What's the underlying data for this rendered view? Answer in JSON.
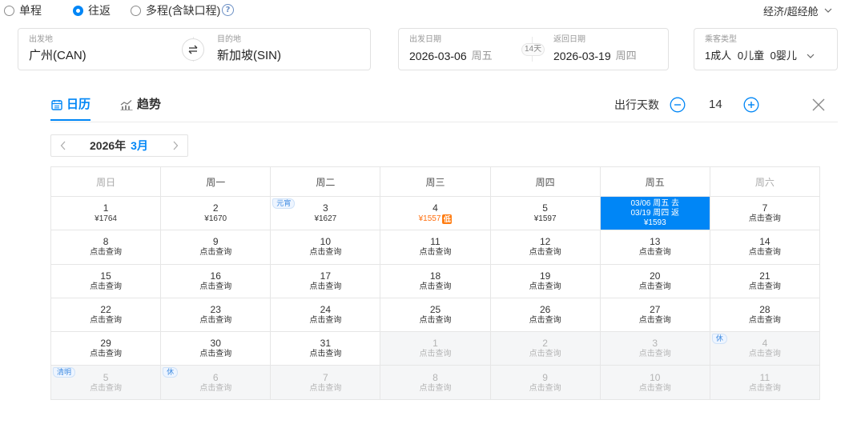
{
  "trip_type": {
    "options": [
      {
        "label": "单程",
        "checked": false
      },
      {
        "label": "往返",
        "checked": true
      },
      {
        "label": "多程(含缺口程)",
        "checked": false
      }
    ],
    "help_icon": "question-circle-icon"
  },
  "cabin": {
    "label": "经济/超经舱",
    "icon": "chevron-down-icon"
  },
  "search": {
    "origin": {
      "label": "出发地",
      "value": "广州(CAN)"
    },
    "swap_icon": "swap-arrows-icon",
    "destination": {
      "label": "目的地",
      "value": "新加坡(SIN)"
    },
    "depart": {
      "label": "出发日期",
      "date": "2026-03-06",
      "weekday": "周五"
    },
    "duration_badge": "14天",
    "return": {
      "label": "返回日期",
      "date": "2026-03-19",
      "weekday": "周四"
    },
    "passengers": {
      "label": "乘客类型",
      "value": "1成人 0儿童 0婴儿"
    }
  },
  "tabs": [
    {
      "label": "日历",
      "icon": "calendar-icon",
      "active": true
    },
    {
      "label": "趋势",
      "icon": "trend-chart-icon",
      "active": false
    }
  ],
  "trip_days": {
    "label": "出行天数",
    "value": "14",
    "decrement_icon": "minus-circle-icon",
    "increment_icon": "plus-circle-icon"
  },
  "close_icon": "close-icon",
  "month_nav": {
    "year": "2026年",
    "month": "3月"
  },
  "calendar": {
    "weekdays": [
      "周日",
      "周一",
      "周二",
      "周三",
      "周四",
      "周五",
      "周六"
    ],
    "weeks": [
      [
        {
          "day": "1",
          "sub": "¥1764"
        },
        {
          "day": "2",
          "sub": "¥1670"
        },
        {
          "day": "3",
          "sub": "¥1627",
          "tag": "元宵"
        },
        {
          "day": "4",
          "sub": "¥1557",
          "low_badge": "低"
        },
        {
          "day": "5",
          "sub": "¥1597"
        },
        {
          "selected": true,
          "lines": [
            "03/06 周五 去",
            "03/19 周四 返",
            "¥1593"
          ]
        },
        {
          "day": "7",
          "sub": "点击查询"
        }
      ],
      [
        {
          "day": "8",
          "sub": "点击查询"
        },
        {
          "day": "9",
          "sub": "点击查询"
        },
        {
          "day": "10",
          "sub": "点击查询"
        },
        {
          "day": "11",
          "sub": "点击查询"
        },
        {
          "day": "12",
          "sub": "点击查询"
        },
        {
          "day": "13",
          "sub": "点击查询"
        },
        {
          "day": "14",
          "sub": "点击查询"
        }
      ],
      [
        {
          "day": "15",
          "sub": "点击查询"
        },
        {
          "day": "16",
          "sub": "点击查询"
        },
        {
          "day": "17",
          "sub": "点击查询"
        },
        {
          "day": "18",
          "sub": "点击查询"
        },
        {
          "day": "19",
          "sub": "点击查询"
        },
        {
          "day": "20",
          "sub": "点击查询"
        },
        {
          "day": "21",
          "sub": "点击查询"
        }
      ],
      [
        {
          "day": "22",
          "sub": "点击查询"
        },
        {
          "day": "23",
          "sub": "点击查询"
        },
        {
          "day": "24",
          "sub": "点击查询"
        },
        {
          "day": "25",
          "sub": "点击查询"
        },
        {
          "day": "26",
          "sub": "点击查询"
        },
        {
          "day": "27",
          "sub": "点击查询"
        },
        {
          "day": "28",
          "sub": "点击查询"
        }
      ],
      [
        {
          "day": "29",
          "sub": "点击查询"
        },
        {
          "day": "30",
          "sub": "点击查询"
        },
        {
          "day": "31",
          "sub": "点击查询"
        },
        {
          "day": "1",
          "sub": "点击查询",
          "other_month": true
        },
        {
          "day": "2",
          "sub": "点击查询",
          "other_month": true
        },
        {
          "day": "3",
          "sub": "点击查询",
          "other_month": true
        },
        {
          "day": "4",
          "sub": "点击查询",
          "other_month": true,
          "tag": "休"
        }
      ],
      [
        {
          "day": "5",
          "sub": "点击查询",
          "other_month": true,
          "tag": "清明"
        },
        {
          "day": "6",
          "sub": "点击查询",
          "other_month": true,
          "tag": "休"
        },
        {
          "day": "7",
          "sub": "点击查询",
          "other_month": true
        },
        {
          "day": "8",
          "sub": "点击查询",
          "other_month": true
        },
        {
          "day": "9",
          "sub": "点击查询",
          "other_month": true
        },
        {
          "day": "10",
          "sub": "点击查询",
          "other_month": true
        },
        {
          "day": "11",
          "sub": "点击查询",
          "other_month": true
        }
      ]
    ]
  },
  "colors": {
    "accent": "#0086f6",
    "low_price": "#ff6f0f",
    "low_badge_bg": "#ff7d13",
    "holiday_tag": "#3d8ae0"
  }
}
